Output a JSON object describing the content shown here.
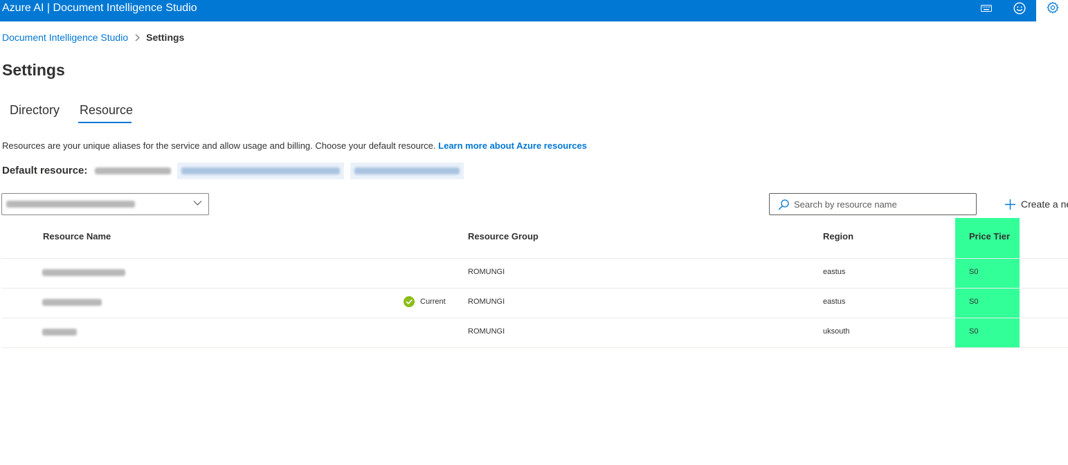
{
  "header": {
    "app_title": "Azure AI | Document Intelligence Studio",
    "icons": [
      "keyboard-icon",
      "smiley-feedback-icon",
      "gear-icon"
    ]
  },
  "breadcrumb": {
    "root": "Document Intelligence Studio",
    "current": "Settings"
  },
  "page": {
    "title": "Settings"
  },
  "tabs": [
    {
      "label": "Directory",
      "selected": false
    },
    {
      "label": "Resource",
      "selected": true
    }
  ],
  "resource_panel": {
    "description": "Resources are your unique aliases for the service and allow usage and billing. Choose your default resource.",
    "learn_more": "Learn more about Azure resources",
    "default_resource_label": "Default resource:",
    "search_placeholder": "Search by resource name",
    "create_label": "Create a ne"
  },
  "table": {
    "columns": [
      "Resource Name",
      "Resource Group",
      "Region",
      "Price Tier"
    ],
    "rows": [
      {
        "resource_group": "ROMUNGI",
        "region": "eastus",
        "price_tier": "S0",
        "current": false
      },
      {
        "resource_group": "ROMUNGI",
        "region": "eastus",
        "price_tier": "S0",
        "current": true,
        "current_label": "Current"
      },
      {
        "resource_group": "ROMUNGI",
        "region": "uksouth",
        "price_tier": "S0",
        "current": false
      }
    ]
  },
  "colors": {
    "brand_blue": "#0078d4",
    "highlight_green": "#33ff99",
    "current_check_green": "#8cbd18"
  }
}
